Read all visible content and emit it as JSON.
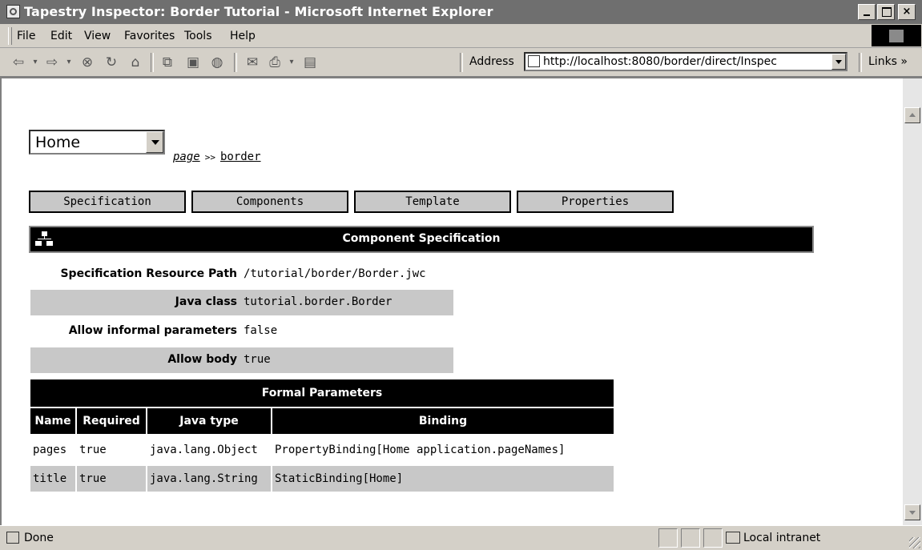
{
  "window": {
    "title": "Tapestry Inspector: Border Tutorial - Microsoft Internet Explorer",
    "min_label": "",
    "close_label": "×"
  },
  "menu": {
    "items": [
      "File",
      "Edit",
      "View",
      "Favorites",
      "Tools",
      "Help"
    ]
  },
  "toolbar": {
    "address_label": "Address",
    "url": "http://localhost:8080/border/direct/Inspec",
    "links_label": "Links »"
  },
  "inspector": {
    "page_select_value": "Home",
    "breadcrumb": {
      "page": "page",
      "separator": ">>",
      "component": "border"
    },
    "tabs": [
      "Specification",
      "Components",
      "Template",
      "Properties"
    ],
    "section_title": "Component Specification",
    "spec_rows": [
      {
        "label": "Specification Resource Path",
        "value": "/tutorial/border/Border.jwc"
      },
      {
        "label": "Java class",
        "value": "tutorial.border.Border"
      },
      {
        "label": "Allow informal parameters",
        "value": "false"
      },
      {
        "label": "Allow body",
        "value": "true"
      }
    ],
    "formal_params": {
      "title": "Formal Parameters",
      "columns": [
        "Name",
        "Required",
        "Java type",
        "Binding"
      ],
      "rows": [
        [
          "pages",
          "true",
          "java.lang.Object",
          "PropertyBinding[Home application.pageNames]"
        ],
        [
          "title",
          "true",
          "java.lang.String",
          "StaticBinding[Home]"
        ]
      ]
    }
  },
  "status": {
    "text": "Done",
    "zone": "Local intranet"
  }
}
